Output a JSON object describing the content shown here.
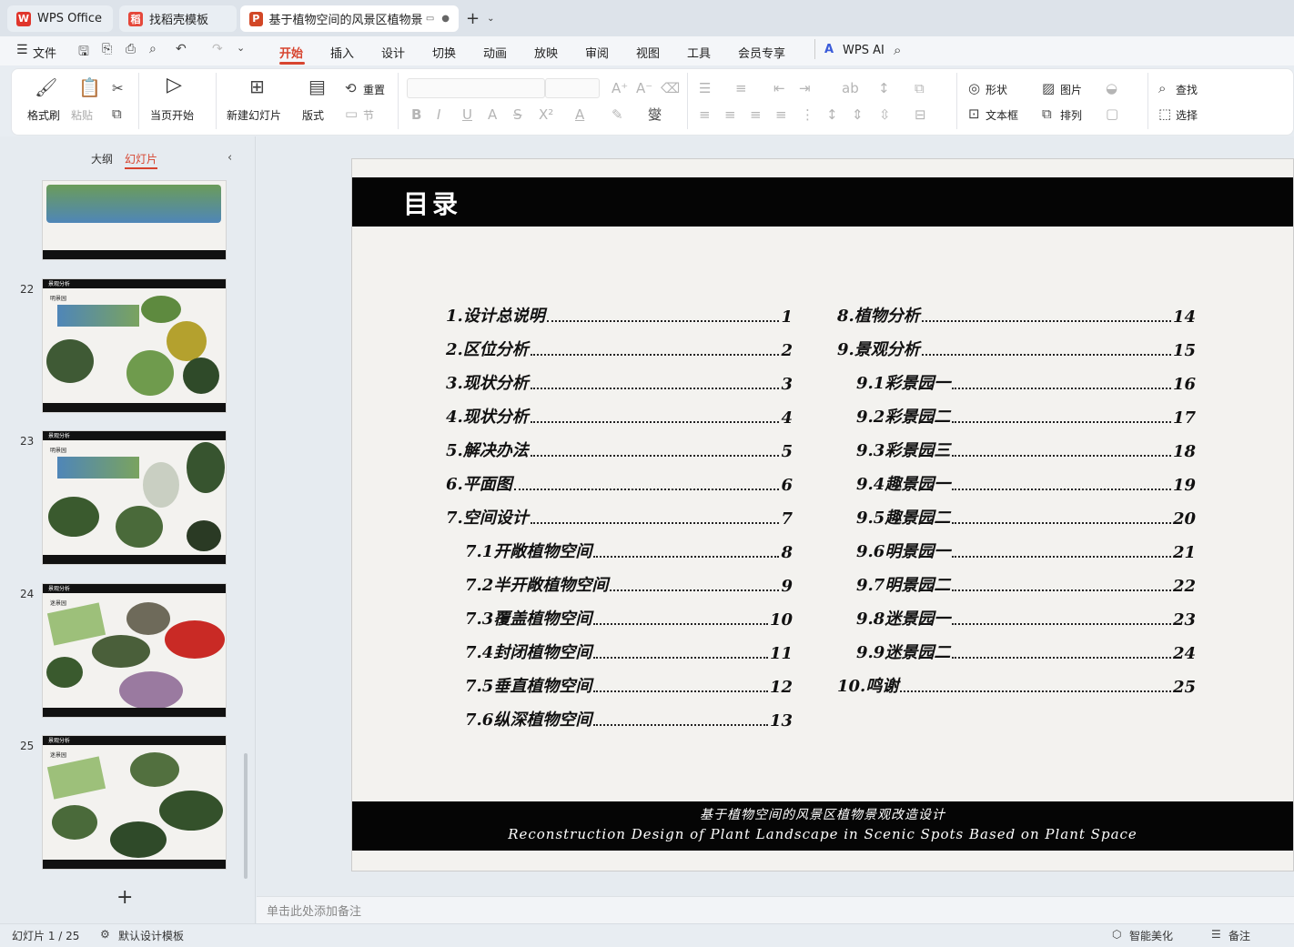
{
  "tabs": {
    "wps_label": "WPS Office",
    "template_label": "找稻壳模板",
    "doc_label": "基于植物空间的风景区植物景观改造设计",
    "add": "+"
  },
  "menu": {
    "file": "文件",
    "items": [
      "开始",
      "插入",
      "设计",
      "切换",
      "动画",
      "放映",
      "审阅",
      "视图",
      "工具",
      "会员专享"
    ],
    "wps_ai": "WPS AI"
  },
  "ribbon": {
    "format_painter": "格式刷",
    "paste": "粘贴",
    "from_current": "当页开始",
    "new_slide": "新建幻灯片",
    "layout": "版式",
    "reset": "重置",
    "section": "节",
    "shape": "形状",
    "picture": "图片",
    "textbox": "文本框",
    "arrange": "排列",
    "find": "查找",
    "select": "选择"
  },
  "panel": {
    "outline_tab": "大纲",
    "slides_tab": "幻灯片",
    "slide_numbers": [
      "22",
      "23",
      "24",
      "25"
    ],
    "thumb_texts": [
      {
        "header": "景观分析",
        "label": "明景园"
      },
      {
        "header": "景观分析",
        "label": "明景园"
      },
      {
        "header": "景观分析",
        "label": "迷景园"
      },
      {
        "header": "景观分析",
        "label": "迷景园"
      }
    ],
    "add": "+"
  },
  "slide": {
    "title": "目录",
    "toc_left": [
      {
        "text": "1.设计总说明",
        "page": "1"
      },
      {
        "text": "2.区位分析",
        "page": "2"
      },
      {
        "text": "3.现状分析",
        "page": "3"
      },
      {
        "text": "4.现状分析",
        "page": "4"
      },
      {
        "text": "5.解决办法",
        "page": "5"
      },
      {
        "text": "6.平面图",
        "page": "6"
      },
      {
        "text": "7.空间设计",
        "page": "7"
      },
      {
        "text": "7.1开敞植物空间",
        "page": "8"
      },
      {
        "text": "7.2半开敞植物空间",
        "page": "9"
      },
      {
        "text": "7.3覆盖植物空间",
        "page": "10"
      },
      {
        "text": "7.4封闭植物空间",
        "page": "11"
      },
      {
        "text": "7.5垂直植物空间",
        "page": "12"
      },
      {
        "text": "7.6纵深植物空间",
        "page": "13"
      }
    ],
    "toc_right": [
      {
        "text": "8.植物分析",
        "page": "14"
      },
      {
        "text": "9.景观分析",
        "page": "15"
      },
      {
        "text": "9.1彩景园一",
        "page": "16"
      },
      {
        "text": "9.2彩景园二",
        "page": "17"
      },
      {
        "text": "9.3彩景园三",
        "page": "18"
      },
      {
        "text": "9.4趣景园一",
        "page": "19"
      },
      {
        "text": "9.5趣景园二",
        "page": "20"
      },
      {
        "text": "9.6明景园一",
        "page": "21"
      },
      {
        "text": "9.7明景园二",
        "page": "22"
      },
      {
        "text": "9.8迷景园一",
        "page": "23"
      },
      {
        "text": "9.9迷景园二",
        "page": "24"
      },
      {
        "text": "10.鸣谢",
        "page": "25"
      }
    ],
    "footer_cn": "基于植物空间的风景区植物景观改造设计",
    "footer_en": "Reconstruction Design of Plant Landscape in Scenic Spots Based on Plant Space"
  },
  "notes_placeholder": "单击此处添加备注",
  "status": {
    "slide_counter": "幻灯片 1 / 25",
    "template": "默认设计模板",
    "beautify": "智能美化",
    "notes": "备注"
  },
  "colors": {
    "accent": "#d7442f",
    "slide_bar": "#050505"
  }
}
